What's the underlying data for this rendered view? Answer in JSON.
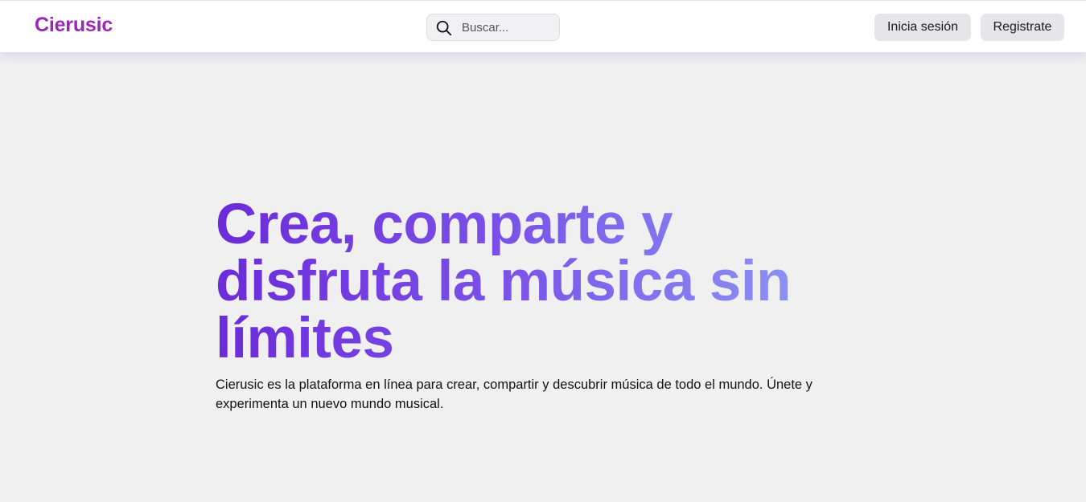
{
  "header": {
    "logo": "Cierusic",
    "search": {
      "placeholder": "Buscar..."
    },
    "login_label": "Inicia sesión",
    "register_label": "Registrate"
  },
  "hero": {
    "title": "Crea, comparte y disfruta la música sin límites",
    "subtitle": "Cierusic es la plataforma en línea para crear, compartir y descubrir música de todo el mundo. Únete y experimenta un nuevo mundo musical."
  },
  "colors": {
    "brand": "#9b27b8",
    "gradient_start": "#6c2bd9",
    "gradient_end": "#8fa0f5",
    "page_bg": "#f0f0f0"
  },
  "icons": {
    "search": "search-icon"
  }
}
